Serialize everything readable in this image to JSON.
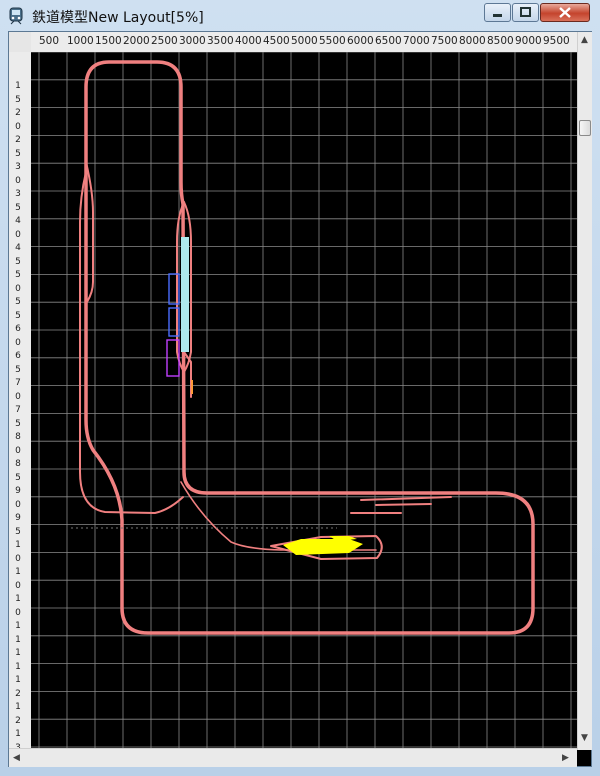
{
  "window": {
    "title": "鉄道模型New Layout[5%]",
    "icon": "app-train-icon",
    "buttons": [
      "minimize-icon",
      "maximize-icon",
      "close-icon"
    ]
  },
  "ruler": {
    "x_labels": [
      "500",
      "1000",
      "1500",
      "2000",
      "2500",
      "3000",
      "3500",
      "4000",
      "4500",
      "5000",
      "5500",
      "6000",
      "6500",
      "7000",
      "7500",
      "8000",
      "8500",
      "9000",
      "9500"
    ],
    "y_labels": [
      "1",
      "5",
      "2",
      "0",
      "2",
      "5",
      "3",
      "0",
      "3",
      "5",
      "4",
      "0",
      "4",
      "5",
      "5",
      "0",
      "5",
      "5",
      "6",
      "0",
      "6",
      "5",
      "7",
      "0",
      "7",
      "5",
      "8",
      "0",
      "8",
      "5",
      "9",
      "0",
      "9",
      "5",
      "1",
      "0",
      "1",
      "0",
      "1",
      "0",
      "1",
      "1",
      "1",
      "1",
      "1",
      "2",
      "1",
      "2",
      "1",
      "3"
    ]
  },
  "canvas": {
    "background": "#000000",
    "grid_color": "#8a8a8a",
    "track_color": "#f08080",
    "highlight_color": "#ffff00"
  }
}
